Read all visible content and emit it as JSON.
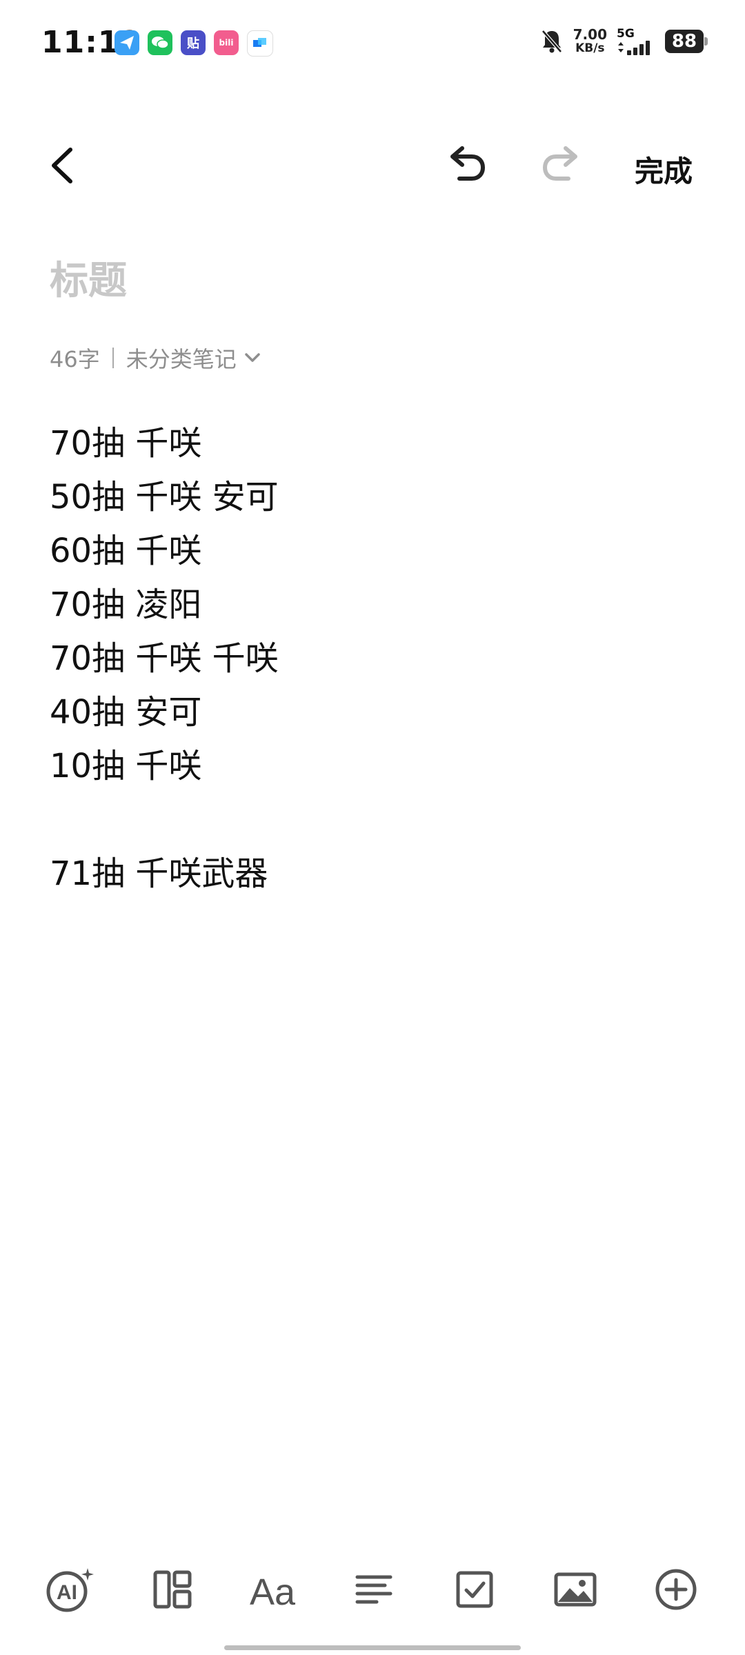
{
  "status_bar": {
    "time": "11:12",
    "net_speed_value": "7.00",
    "net_speed_unit": "KB/s",
    "network_type": "5G",
    "battery": "88",
    "notification_icons": [
      "feishu-icon",
      "wechat-icon",
      "tieba-icon",
      "bilibili-icon",
      "dingtalk-icon"
    ]
  },
  "toolbar": {
    "done_label": "完成"
  },
  "note": {
    "title_placeholder": "标题",
    "char_count": "46字",
    "category": "未分类笔记",
    "lines": [
      "70抽 千咲",
      "50抽 千咲 安可",
      "60抽 千咲",
      "70抽 凌阳",
      "70抽 千咲 千咲",
      "40抽 安可",
      "10抽 千咲",
      "",
      "71抽 千咲武器"
    ]
  },
  "bottom_tools": [
    "ai-icon",
    "layout-icon",
    "text-format-icon",
    "align-icon",
    "checklist-icon",
    "image-icon",
    "add-icon"
  ],
  "colors": {
    "text": "#111111",
    "placeholder": "#c8c8c8",
    "meta": "#8e8e8e",
    "icon": "#555555",
    "disabled_icon": "#bdbdbd"
  }
}
